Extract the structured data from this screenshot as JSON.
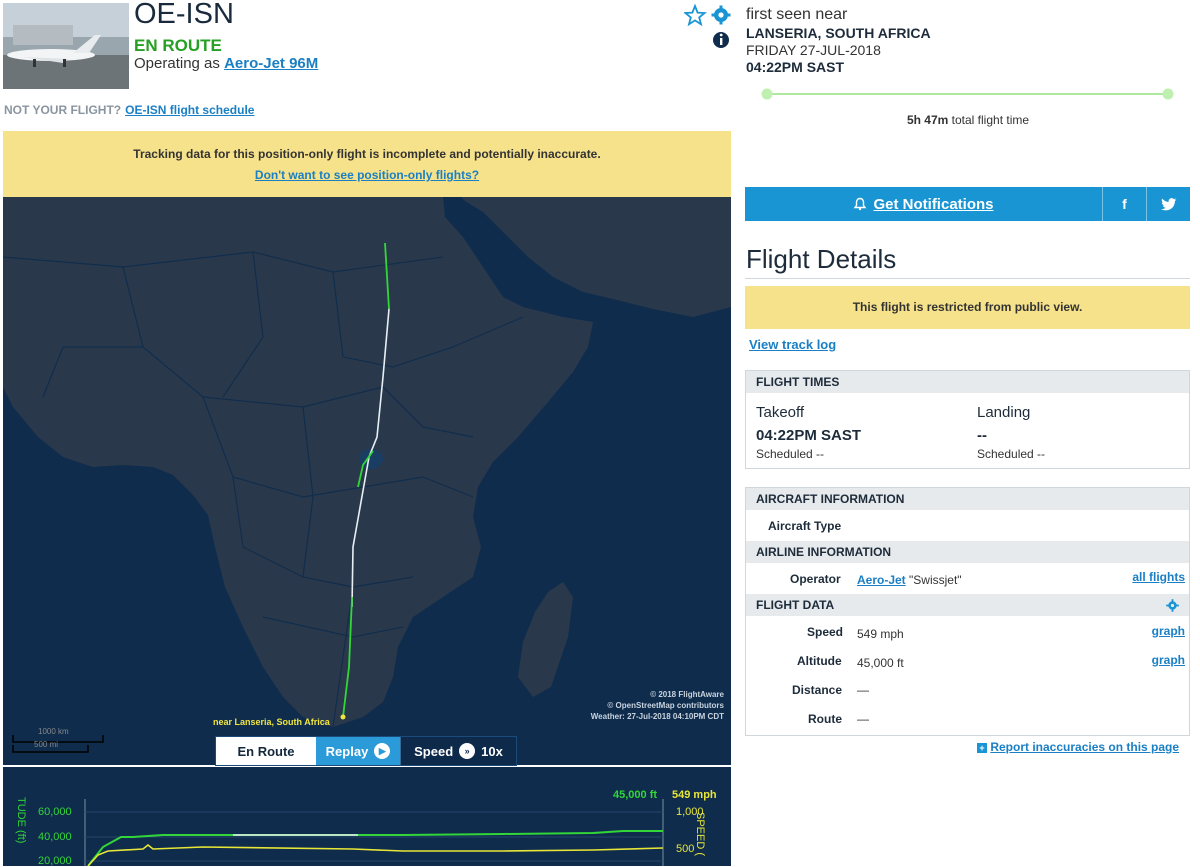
{
  "flight": {
    "ident": "OE-ISN",
    "status": "EN ROUTE",
    "operating_prefix": "Operating as ",
    "operating_callsign": "Aero-Jet 96M",
    "not_your_flight": "NOT YOUR FLIGHT?",
    "schedule_link": "OE-ISN flight schedule",
    "thumbnail_icon": "aircraft-photo"
  },
  "banner": {
    "message": "Tracking data for this position-only flight is incomplete and potentially inaccurate.",
    "link": "Don't want to see position-only flights?"
  },
  "map": {
    "near_label": "near Lanseria, South Africa",
    "copyright": "© 2018 FlightAware",
    "osm": "© OpenStreetMap contributors",
    "weather": "Weather: 27-Jul-2018 04:10PM CDT",
    "scale_km": "1000 km",
    "scale_mi": "500 mi",
    "controls": {
      "en_route": "En Route",
      "replay": "Replay",
      "speed": "Speed",
      "speed_value": "10x"
    },
    "colors": {
      "ocean": "#0f2c4d",
      "land": "#29394b",
      "track_green": "#32d638",
      "track_white": "#e8eef4"
    }
  },
  "graph": {
    "altitude_readout": "45,000 ft",
    "speed_readout": "549 mph",
    "alt_ticks": [
      "60,000",
      "40,000",
      "20,000"
    ],
    "speed_ticks": [
      "1,000",
      "500"
    ],
    "alt_axis_label": "TUDE (ft)",
    "speed_axis_label": "SPEED (",
    "colors": {
      "altitude": "#32d638",
      "speed": "#e8e636"
    }
  },
  "origin": {
    "first_seen": "first seen near",
    "place": "LANSERIA, SOUTH AFRICA",
    "date": "FRIDAY 27-JUL-2018",
    "time": "04:22PM SAST",
    "total_time_value": "5h 47m",
    "total_time_label": " total flight time"
  },
  "actions": {
    "notifications": "Get Notifications",
    "facebook": "f",
    "twitter": "twitter"
  },
  "details": {
    "title": "Flight Details",
    "restricted": "This flight is restricted from public view.",
    "track_log": "View track log"
  },
  "flight_times": {
    "header": "FLIGHT TIMES",
    "takeoff_label": "Takeoff",
    "takeoff_time": "04:22PM SAST",
    "takeoff_sched": "Scheduled --",
    "landing_label": "Landing",
    "landing_time": "--",
    "landing_sched": "Scheduled --"
  },
  "aircraft": {
    "header": "AIRCRAFT INFORMATION",
    "type_label": "Aircraft Type",
    "airline_header": "AIRLINE INFORMATION",
    "operator_label": "Operator",
    "operator_link": "Aero-Jet",
    "operator_name": " \"Swissjet\"",
    "all_flights": "all flights"
  },
  "flight_data": {
    "header": "FLIGHT DATA",
    "speed_label": "Speed",
    "speed_value": "549 mph",
    "altitude_label": "Altitude",
    "altitude_value": "45,000 ft",
    "distance_label": "Distance",
    "distance_value": "—",
    "route_label": "Route",
    "route_value": "—",
    "graph": "graph"
  },
  "footer": {
    "report": "Report inaccuracies on this page"
  }
}
